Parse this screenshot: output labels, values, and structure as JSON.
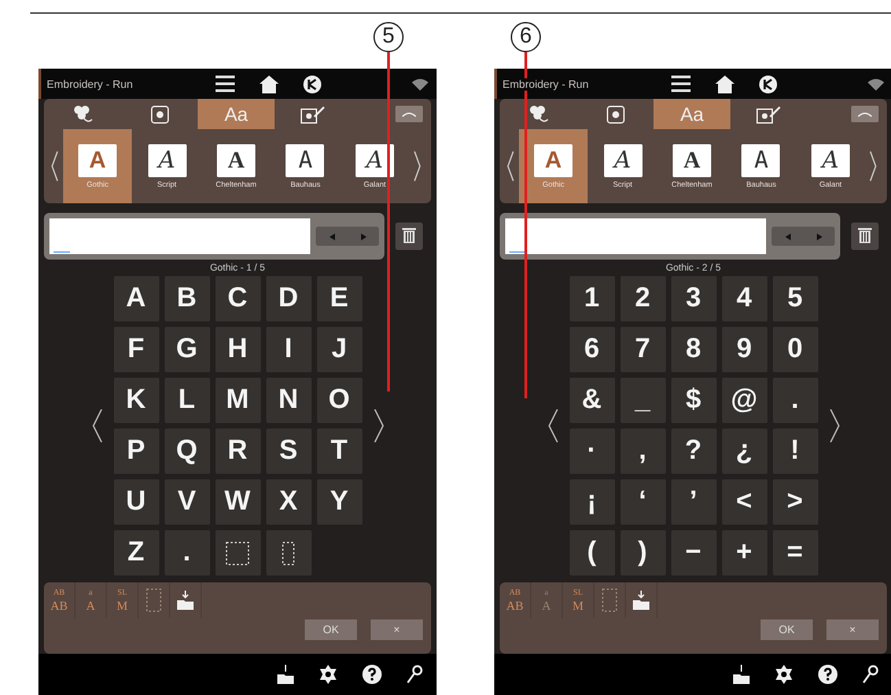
{
  "callouts": [
    {
      "label": "5"
    },
    {
      "label": "6"
    }
  ],
  "screens": [
    {
      "title": "Embroidery - Run",
      "tabs": [
        {
          "kind": "flower",
          "selected": false
        },
        {
          "kind": "hoop",
          "selected": false
        },
        {
          "kind": "text",
          "label": "Aa",
          "selected": true
        },
        {
          "kind": "edit",
          "selected": false
        }
      ],
      "fonts": [
        {
          "sample": "A",
          "kind": "sans",
          "label": "Gothic",
          "selected": true
        },
        {
          "sample": "A",
          "kind": "script",
          "label": "Script",
          "selected": false
        },
        {
          "sample": "A",
          "kind": "serif",
          "label": "Cheltenham",
          "selected": false
        },
        {
          "sample": "A",
          "kind": "round",
          "label": "Bauhaus",
          "selected": false
        },
        {
          "sample": "A",
          "kind": "swash",
          "label": "Galant",
          "selected": false
        }
      ],
      "caption": "Gothic - 1 / 5",
      "keys": [
        [
          {
            "kind": "char",
            "label": "A"
          },
          {
            "kind": "char",
            "label": "B"
          },
          {
            "kind": "char",
            "label": "C"
          },
          {
            "kind": "char",
            "label": "D"
          },
          {
            "kind": "char",
            "label": "E"
          }
        ],
        [
          {
            "kind": "char",
            "label": "F"
          },
          {
            "kind": "char",
            "label": "G"
          },
          {
            "kind": "char",
            "label": "H"
          },
          {
            "kind": "char",
            "label": "I"
          },
          {
            "kind": "char",
            "label": "J"
          }
        ],
        [
          {
            "kind": "char",
            "label": "K"
          },
          {
            "kind": "char",
            "label": "L"
          },
          {
            "kind": "char",
            "label": "M"
          },
          {
            "kind": "char",
            "label": "N"
          },
          {
            "kind": "char",
            "label": "O"
          }
        ],
        [
          {
            "kind": "char",
            "label": "P"
          },
          {
            "kind": "char",
            "label": "Q"
          },
          {
            "kind": "char",
            "label": "R"
          },
          {
            "kind": "char",
            "label": "S"
          },
          {
            "kind": "char",
            "label": "T"
          }
        ],
        [
          {
            "kind": "char",
            "label": "U"
          },
          {
            "kind": "char",
            "label": "V"
          },
          {
            "kind": "char",
            "label": "W"
          },
          {
            "kind": "char",
            "label": "X"
          },
          {
            "kind": "char",
            "label": "Y"
          }
        ],
        [
          {
            "kind": "char",
            "label": "Z"
          },
          {
            "kind": "char",
            "label": "."
          },
          {
            "kind": "space-wide"
          },
          {
            "kind": "space-narrow"
          }
        ]
      ],
      "tools": [
        {
          "kind": "text",
          "top": "AB",
          "bottom": "AB",
          "disabled": false
        },
        {
          "kind": "text",
          "top": "a",
          "bottom": "A",
          "disabled": false
        },
        {
          "kind": "text",
          "top": "SL",
          "bottom": "M",
          "disabled": false
        },
        {
          "kind": "frame",
          "disabled": true
        },
        {
          "kind": "load",
          "disabled": false
        }
      ],
      "ok": "OK",
      "cancel": "×"
    },
    {
      "title": "Embroidery - Run",
      "tabs": [
        {
          "kind": "flower",
          "selected": false
        },
        {
          "kind": "hoop",
          "selected": false
        },
        {
          "kind": "text",
          "label": "Aa",
          "selected": true
        },
        {
          "kind": "edit",
          "selected": false
        }
      ],
      "fonts": [
        {
          "sample": "A",
          "kind": "sans",
          "label": "Gothic",
          "selected": true
        },
        {
          "sample": "A",
          "kind": "script",
          "label": "Script",
          "selected": false
        },
        {
          "sample": "A",
          "kind": "serif",
          "label": "Cheltenham",
          "selected": false
        },
        {
          "sample": "A",
          "kind": "round",
          "label": "Bauhaus",
          "selected": false
        },
        {
          "sample": "A",
          "kind": "swash",
          "label": "Galant",
          "selected": false
        }
      ],
      "caption": "Gothic - 2 / 5",
      "keys": [
        [
          {
            "kind": "char",
            "label": "1"
          },
          {
            "kind": "char",
            "label": "2"
          },
          {
            "kind": "char",
            "label": "3"
          },
          {
            "kind": "char",
            "label": "4"
          },
          {
            "kind": "char",
            "label": "5"
          }
        ],
        [
          {
            "kind": "char",
            "label": "6"
          },
          {
            "kind": "char",
            "label": "7"
          },
          {
            "kind": "char",
            "label": "8"
          },
          {
            "kind": "char",
            "label": "9"
          },
          {
            "kind": "char",
            "label": "0"
          }
        ],
        [
          {
            "kind": "char",
            "label": "&"
          },
          {
            "kind": "char",
            "label": "_"
          },
          {
            "kind": "char",
            "label": "$"
          },
          {
            "kind": "char",
            "label": "@"
          },
          {
            "kind": "char",
            "label": "."
          }
        ],
        [
          {
            "kind": "char",
            "label": "·"
          },
          {
            "kind": "char",
            "label": ","
          },
          {
            "kind": "char",
            "label": "?"
          },
          {
            "kind": "char",
            "label": "¿"
          },
          {
            "kind": "char",
            "label": "!"
          }
        ],
        [
          {
            "kind": "char",
            "label": "¡"
          },
          {
            "kind": "char",
            "label": "‘"
          },
          {
            "kind": "char",
            "label": "’"
          },
          {
            "kind": "char",
            "label": "<"
          },
          {
            "kind": "char",
            "label": ">"
          }
        ],
        [
          {
            "kind": "char",
            "label": "("
          },
          {
            "kind": "char",
            "label": ")"
          },
          {
            "kind": "char",
            "label": "−"
          },
          {
            "kind": "char",
            "label": "+"
          },
          {
            "kind": "char",
            "label": "="
          }
        ]
      ],
      "tools": [
        {
          "kind": "text",
          "top": "AB",
          "bottom": "AB",
          "disabled": false
        },
        {
          "kind": "text",
          "top": "a",
          "bottom": "A",
          "disabled": true
        },
        {
          "kind": "text",
          "top": "SL",
          "bottom": "M",
          "disabled": false
        },
        {
          "kind": "frame",
          "disabled": true
        },
        {
          "kind": "load",
          "disabled": false
        }
      ],
      "ok": "OK",
      "cancel": "×"
    }
  ]
}
